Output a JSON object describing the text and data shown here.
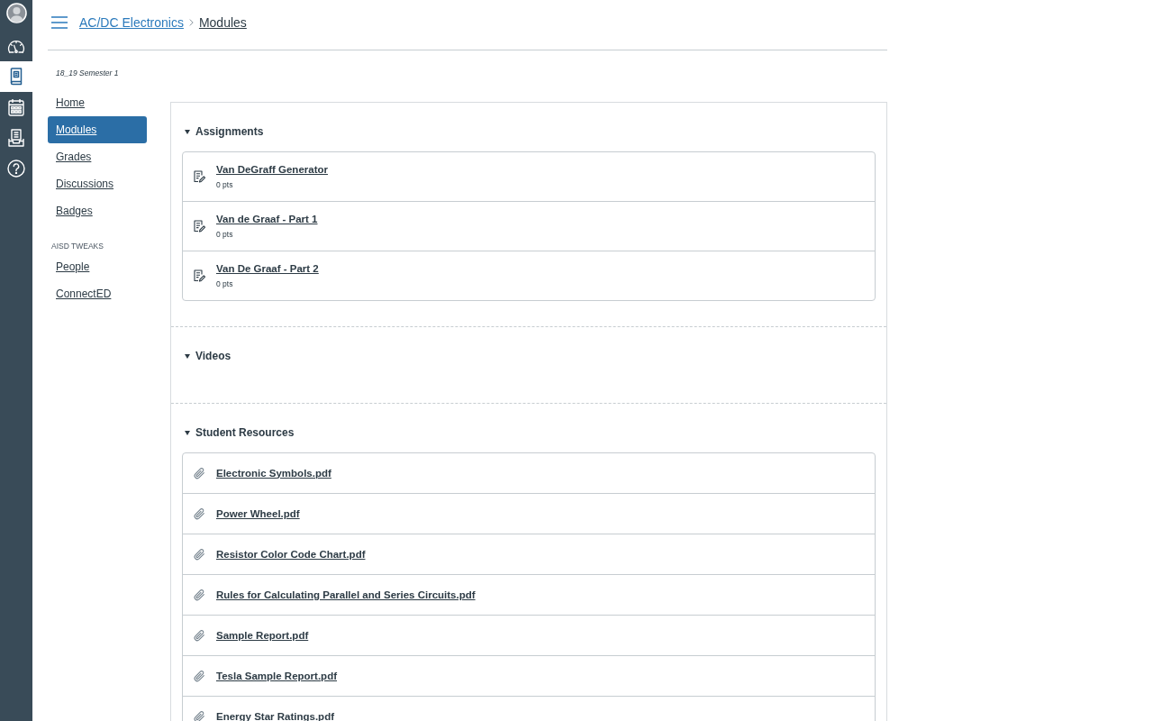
{
  "global_nav": [
    {
      "kind": "account",
      "selected": false
    },
    {
      "kind": "dashboard",
      "selected": false
    },
    {
      "kind": "courses",
      "selected": true
    },
    {
      "kind": "calendar",
      "selected": false
    },
    {
      "kind": "inbox",
      "selected": false
    },
    {
      "kind": "help",
      "selected": false
    }
  ],
  "header": {
    "breadcrumb": [
      {
        "label": "AC/DC Electronics",
        "current": false
      },
      {
        "label": "Modules",
        "current": true
      }
    ]
  },
  "course_nav": {
    "term": "18_19 Semester 1",
    "items": [
      {
        "label": "Home",
        "selected": false
      },
      {
        "label": "Modules",
        "selected": true
      },
      {
        "label": "Grades",
        "selected": false
      },
      {
        "label": "Discussions",
        "selected": false
      },
      {
        "label": "Badges",
        "selected": false
      }
    ],
    "groups": [
      {
        "heading": "AISD TWEAKS",
        "items": [
          {
            "label": "People",
            "selected": false
          },
          {
            "label": "ConnectED",
            "selected": false
          }
        ]
      }
    ]
  },
  "modules": [
    {
      "title": "Assignments",
      "expanded": true,
      "items": [
        {
          "kind": "assignment",
          "title": "Van DeGraff Generator",
          "points": "0 pts"
        },
        {
          "kind": "assignment",
          "title": "Van de Graaf - Part 1",
          "points": "0 pts"
        },
        {
          "kind": "assignment",
          "title": "Van De Graaf - Part 2",
          "points": "0 pts"
        }
      ]
    },
    {
      "title": "Videos",
      "expanded": true
    },
    {
      "title": "Student Resources",
      "expanded": true,
      "items": [
        {
          "kind": "attachment",
          "title": "Electronic Symbols.pdf"
        },
        {
          "kind": "attachment",
          "title": "Power Wheel.pdf"
        },
        {
          "kind": "attachment",
          "title": "Resistor Color Code Chart.pdf"
        },
        {
          "kind": "attachment",
          "title": "Rules for Calculating Parallel and Series Circuits.pdf"
        },
        {
          "kind": "attachment",
          "title": "Sample Report.pdf"
        },
        {
          "kind": "attachment",
          "title": "Tesla Sample Report.pdf"
        },
        {
          "kind": "attachment",
          "title": "Energy Star Ratings.pdf"
        }
      ]
    }
  ]
}
